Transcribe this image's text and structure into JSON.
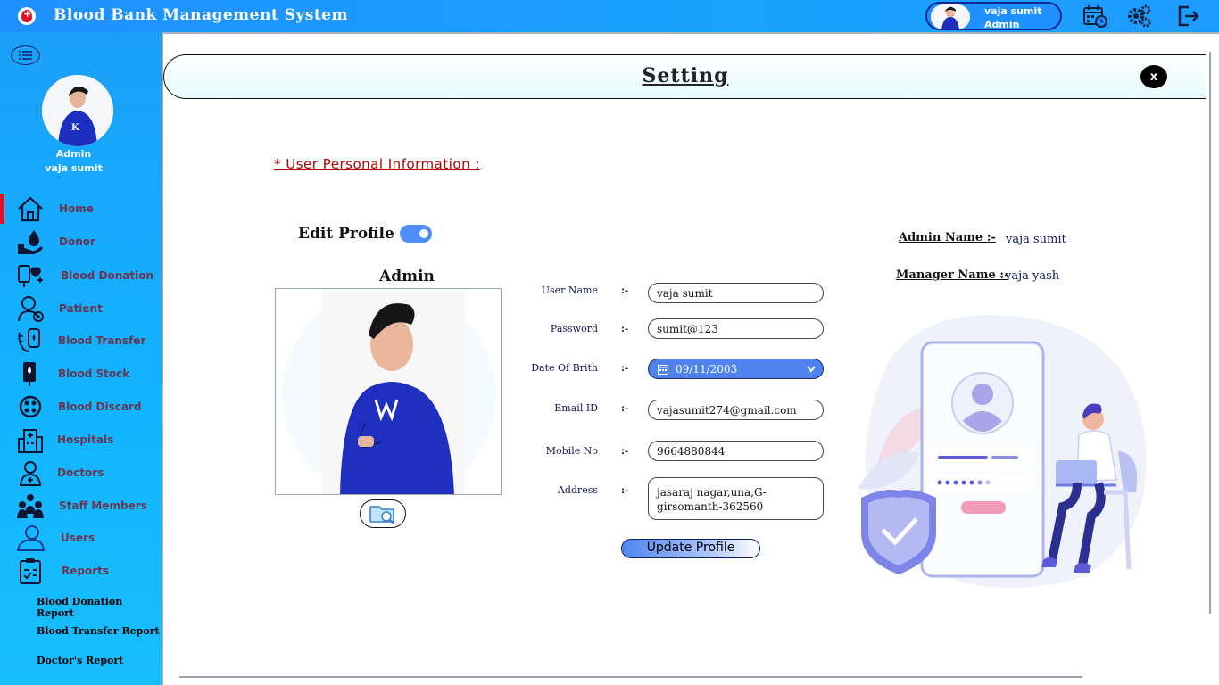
{
  "app": {
    "title": "Blood Bank Management System",
    "accent_color": "#1e90ff",
    "brand_color": "#e0102a"
  },
  "topbar": {
    "user_name": "vaja sumit",
    "user_role": "Admin",
    "icons": [
      "calendar-clock-icon",
      "settings-gears-icon",
      "logout-icon"
    ]
  },
  "sidebar": {
    "role": "Admin",
    "name": "vaja sumit",
    "items": [
      {
        "label": "Home",
        "icon": "home-icon",
        "active": true
      },
      {
        "label": "Donor",
        "icon": "donor-icon"
      },
      {
        "label": "Blood Donation",
        "icon": "blood-donation-icon"
      },
      {
        "label": "Patient",
        "icon": "patient-icon"
      },
      {
        "label": "Blood Transfer",
        "icon": "blood-transfer-icon"
      },
      {
        "label": "Blood Stock",
        "icon": "blood-stock-icon"
      },
      {
        "label": "Blood Discard",
        "icon": "blood-discard-icon"
      },
      {
        "label": "Hospitals",
        "icon": "hospitals-icon"
      },
      {
        "label": "Doctors",
        "icon": "doctors-icon"
      },
      {
        "label": "Staff Members",
        "icon": "staff-members-icon"
      },
      {
        "label": "Users",
        "icon": "users-icon"
      },
      {
        "label": "Reports",
        "icon": "reports-icon"
      }
    ],
    "reports": [
      "Blood Donation Report",
      "Blood Transfer Report",
      "Doctor's  Report"
    ]
  },
  "page": {
    "title": "Setting",
    "close_label": "x",
    "section_title": "*  User Personal Information  :",
    "edit_label": "Edit Profile  :",
    "edit_enabled": true,
    "photo_caption": "Admin"
  },
  "form": {
    "username_label": "User Name",
    "username_value": "vaja sumit",
    "password_label": "Password",
    "password_value": "sumit@123",
    "dob_label": "Date Of Brith",
    "dob_value": "09/11/2003",
    "email_label": "Email ID",
    "email_value": "vajasumit274@gmail.com",
    "mobile_label": "Mobile No",
    "mobile_value": "9664880844",
    "address_label": "Address",
    "address_value": "jasaraj nagar,una,G-girsomanth-362560",
    "separator": ":-",
    "update_label": "Update Profile"
  },
  "info": {
    "admin_label": "Admin Name  :-",
    "admin_value": "vaja sumit",
    "manager_label": "Manager Name  :-",
    "manager_value": "vaja yash"
  }
}
